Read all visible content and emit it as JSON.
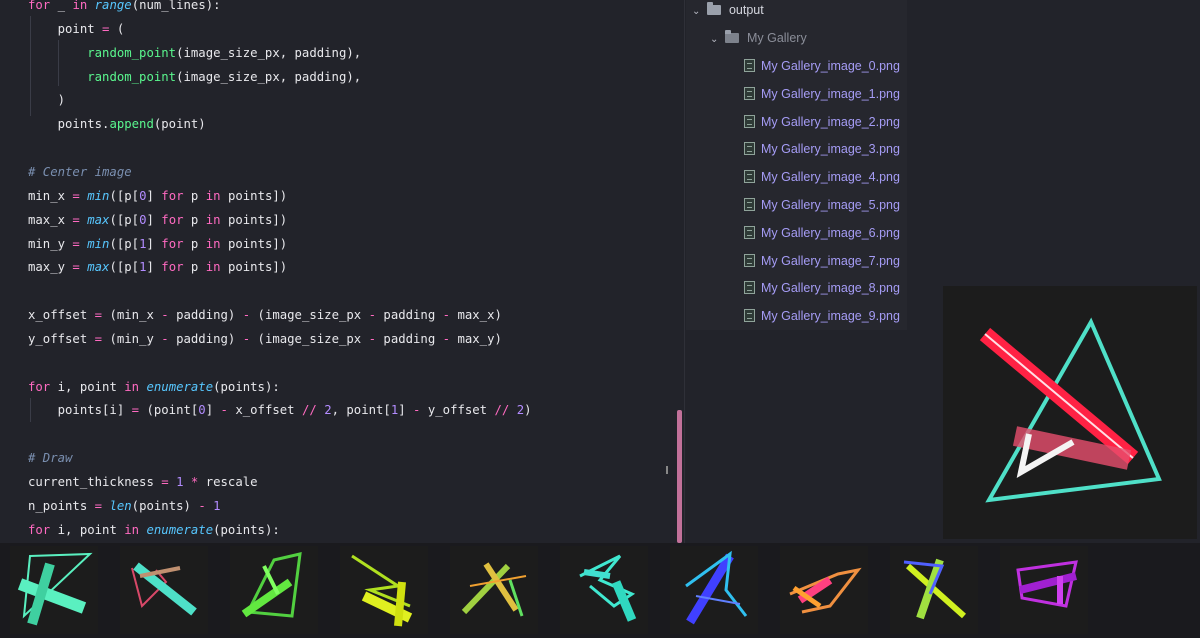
{
  "editor": {
    "lines": [
      [
        [
          "kw",
          "for"
        ],
        [
          "var",
          " _ "
        ],
        [
          "kw",
          "in"
        ],
        [
          "var",
          " "
        ],
        [
          "bi",
          "range"
        ],
        [
          "var",
          "(num_lines):"
        ]
      ],
      [
        [
          "var",
          "    point "
        ],
        [
          "op",
          "="
        ],
        [
          "var",
          " ("
        ]
      ],
      [
        [
          "var",
          "        "
        ],
        [
          "fn",
          "random_point"
        ],
        [
          "var",
          "(image_size_px, padding),"
        ]
      ],
      [
        [
          "var",
          "        "
        ],
        [
          "fn",
          "random_point"
        ],
        [
          "var",
          "(image_size_px, padding),"
        ]
      ],
      [
        [
          "var",
          "    )"
        ]
      ],
      [
        [
          "var",
          "    points."
        ],
        [
          "fn",
          "append"
        ],
        [
          "var",
          "(point)"
        ]
      ],
      [],
      [
        [
          "cm",
          "# Center image"
        ]
      ],
      [
        [
          "var",
          "min_x "
        ],
        [
          "op",
          "="
        ],
        [
          "var",
          " "
        ],
        [
          "bi",
          "min"
        ],
        [
          "var",
          "([p["
        ],
        [
          "num",
          "0"
        ],
        [
          "var",
          "] "
        ],
        [
          "kw",
          "for"
        ],
        [
          "var",
          " p "
        ],
        [
          "kw",
          "in"
        ],
        [
          "var",
          " points])"
        ]
      ],
      [
        [
          "var",
          "max_x "
        ],
        [
          "op",
          "="
        ],
        [
          "var",
          " "
        ],
        [
          "bi",
          "max"
        ],
        [
          "var",
          "([p["
        ],
        [
          "num",
          "0"
        ],
        [
          "var",
          "] "
        ],
        [
          "kw",
          "for"
        ],
        [
          "var",
          " p "
        ],
        [
          "kw",
          "in"
        ],
        [
          "var",
          " points])"
        ]
      ],
      [
        [
          "var",
          "min_y "
        ],
        [
          "op",
          "="
        ],
        [
          "var",
          " "
        ],
        [
          "bi",
          "min"
        ],
        [
          "var",
          "([p["
        ],
        [
          "num",
          "1"
        ],
        [
          "var",
          "] "
        ],
        [
          "kw",
          "for"
        ],
        [
          "var",
          " p "
        ],
        [
          "kw",
          "in"
        ],
        [
          "var",
          " points])"
        ]
      ],
      [
        [
          "var",
          "max_y "
        ],
        [
          "op",
          "="
        ],
        [
          "var",
          " "
        ],
        [
          "bi",
          "max"
        ],
        [
          "var",
          "([p["
        ],
        [
          "num",
          "1"
        ],
        [
          "var",
          "] "
        ],
        [
          "kw",
          "for"
        ],
        [
          "var",
          " p "
        ],
        [
          "kw",
          "in"
        ],
        [
          "var",
          " points])"
        ]
      ],
      [],
      [
        [
          "var",
          "x_offset "
        ],
        [
          "op",
          "="
        ],
        [
          "var",
          " (min_x "
        ],
        [
          "op",
          "-"
        ],
        [
          "var",
          " padding) "
        ],
        [
          "op",
          "-"
        ],
        [
          "var",
          " (image_size_px "
        ],
        [
          "op",
          "-"
        ],
        [
          "var",
          " padding "
        ],
        [
          "op",
          "-"
        ],
        [
          "var",
          " max_x)"
        ]
      ],
      [
        [
          "var",
          "y_offset "
        ],
        [
          "op",
          "="
        ],
        [
          "var",
          " (min_y "
        ],
        [
          "op",
          "-"
        ],
        [
          "var",
          " padding) "
        ],
        [
          "op",
          "-"
        ],
        [
          "var",
          " (image_size_px "
        ],
        [
          "op",
          "-"
        ],
        [
          "var",
          " padding "
        ],
        [
          "op",
          "-"
        ],
        [
          "var",
          " max_y)"
        ]
      ],
      [],
      [
        [
          "kw",
          "for"
        ],
        [
          "var",
          " i, point "
        ],
        [
          "kw",
          "in"
        ],
        [
          "var",
          " "
        ],
        [
          "bi",
          "enumerate"
        ],
        [
          "var",
          "(points):"
        ]
      ],
      [
        [
          "var",
          "    points[i] "
        ],
        [
          "op",
          "="
        ],
        [
          "var",
          " (point["
        ],
        [
          "num",
          "0"
        ],
        [
          "var",
          "] "
        ],
        [
          "op",
          "-"
        ],
        [
          "var",
          " x_offset "
        ],
        [
          "op",
          "//"
        ],
        [
          "var",
          " "
        ],
        [
          "num",
          "2"
        ],
        [
          "var",
          ", point["
        ],
        [
          "num",
          "1"
        ],
        [
          "var",
          "] "
        ],
        [
          "op",
          "-"
        ],
        [
          "var",
          " y_offset "
        ],
        [
          "op",
          "//"
        ],
        [
          "var",
          " "
        ],
        [
          "num",
          "2"
        ],
        [
          "var",
          ")"
        ]
      ],
      [],
      [
        [
          "cm",
          "# Draw"
        ]
      ],
      [
        [
          "var",
          "current_thickness "
        ],
        [
          "op",
          "="
        ],
        [
          "var",
          " "
        ],
        [
          "num",
          "1"
        ],
        [
          "var",
          " "
        ],
        [
          "op",
          "*"
        ],
        [
          "var",
          " rescale"
        ]
      ],
      [
        [
          "var",
          "n_points "
        ],
        [
          "op",
          "="
        ],
        [
          "var",
          " "
        ],
        [
          "bi",
          "len"
        ],
        [
          "var",
          "(points) "
        ],
        [
          "op",
          "-"
        ],
        [
          "var",
          " "
        ],
        [
          "num",
          "1"
        ]
      ],
      [
        [
          "kw",
          "for"
        ],
        [
          "var",
          " i, point "
        ],
        [
          "kw",
          "in"
        ],
        [
          "var",
          " "
        ],
        [
          "bi",
          "enumerate"
        ],
        [
          "var",
          "(points):"
        ]
      ]
    ]
  },
  "file_tree": {
    "root_folder": "output",
    "sub_folder": "My Gallery",
    "files": [
      "My Gallery_image_0.png",
      "My Gallery_image_1.png",
      "My Gallery_image_2.png",
      "My Gallery_image_3.png",
      "My Gallery_image_4.png",
      "My Gallery_image_5.png",
      "My Gallery_image_6.png",
      "My Gallery_image_7.png",
      "My Gallery_image_8.png",
      "My Gallery_image_9.png"
    ]
  },
  "colors": {
    "editor_bg": "#22232a",
    "keyword": "#ff6ac1",
    "function": "#5af78e",
    "builtin": "#57c7ff",
    "number": "#b38cff",
    "comment": "#7a8fb0",
    "file_label": "#a59cf5",
    "scroll_thumb": "#c2719a"
  }
}
